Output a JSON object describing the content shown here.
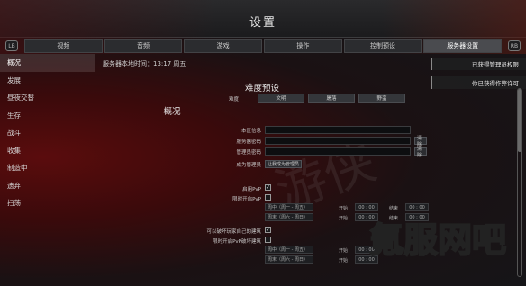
{
  "window": {
    "title": "设置"
  },
  "tabs": {
    "left_key": "LB",
    "right_key": "RB",
    "items": [
      "视频",
      "音频",
      "游戏",
      "操作",
      "控制预设",
      "服务器设置"
    ],
    "active_index": 5
  },
  "sidebar": {
    "items": [
      "概况",
      "发展",
      "昼夜交替",
      "生存",
      "战斗",
      "收集",
      "制造中",
      "遗弃",
      "扫荡"
    ],
    "active_index": 0
  },
  "server_time": {
    "label": "服务器本地时间：",
    "time": "13:17",
    "day": "周五"
  },
  "difficulty": {
    "heading": "难度预设",
    "label": "难度",
    "options": [
      "文明",
      "屠落",
      "野蛮"
    ]
  },
  "overview": {
    "heading": "概况",
    "server_name_label": "本区信息",
    "server_password_label": "服务器密码",
    "admin_password_label": "管理员密码",
    "become_admin_label": "成为管理员",
    "become_admin_button": "让我成为管理员",
    "clear_label": "清除",
    "pvp_label": "启用PvP",
    "pvp_checked": true,
    "timed_pvp_label": "限时开启PvP",
    "timed_pvp_checked": false,
    "weekday_label": "周中（周一 - 周五）",
    "weekend_label": "周末（周六 - 周日）",
    "start_label": "开始",
    "end_label": "结束",
    "time_value": "00 : 00",
    "destroy_label": "可以破坏玩家自己的建筑",
    "destroy_checked": true,
    "timed_destroy_label": "限时开启PvP破坏建筑",
    "timed_destroy_checked": false
  },
  "notifications": [
    "已获得管理员权限",
    "你已获得作弊许可"
  ],
  "watermark": "氪服网吧"
}
